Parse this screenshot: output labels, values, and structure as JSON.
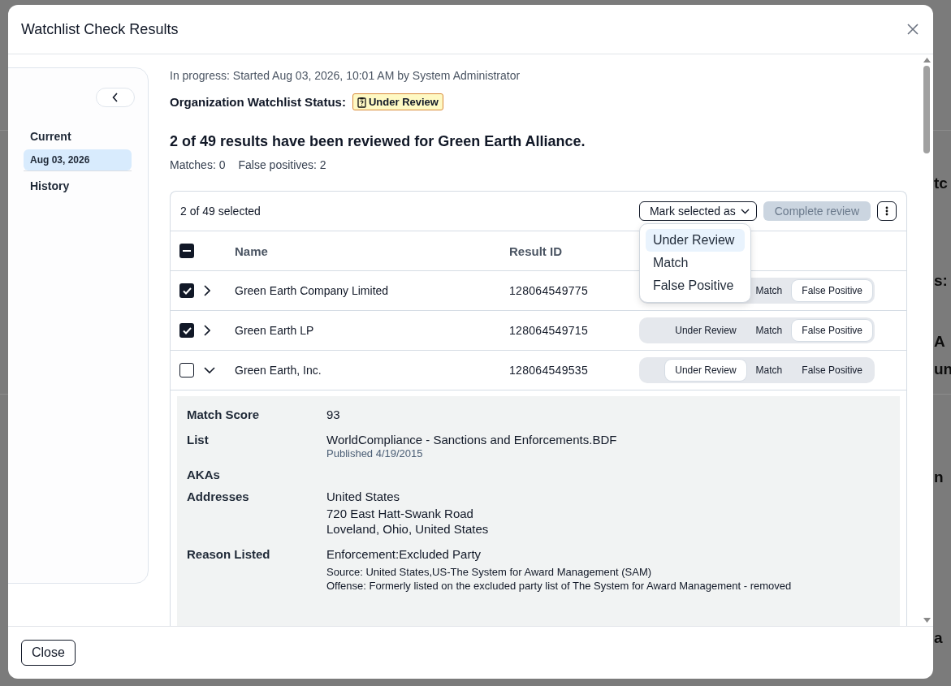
{
  "backdrop": {
    "right_fragments": [
      "tc",
      "s:",
      "A",
      "un",
      "n",
      "a"
    ]
  },
  "window": {
    "title": "Watchlist Check Results"
  },
  "sidebar": {
    "groups": [
      {
        "label": "Current",
        "items": [
          {
            "label": "Aug 03, 2026",
            "selected": true
          }
        ]
      },
      {
        "label": "History"
      }
    ]
  },
  "progress_note": "In progress: Started Aug 03, 2026, 10:01 AM by System Administrator",
  "status": {
    "label": "Organization Watchlist Status:",
    "badge": "Under Review"
  },
  "summary": {
    "heading": "2 of 49 results have been reviewed for Green Earth Alliance.",
    "matches": "Matches: 0",
    "false_positives": "False positives: 2"
  },
  "table": {
    "selection_count": "2 of 49 selected",
    "mark_button": "Mark selected as",
    "complete_button": {
      "label": "Complete review",
      "disabled": true
    },
    "menu": [
      {
        "label": "Under Review",
        "selected": true
      },
      {
        "label": "Match",
        "selected": false
      },
      {
        "label": "False Positive",
        "selected": false
      }
    ],
    "select_all": {
      "indeterminate": true
    },
    "columns": [
      "Name",
      "Result ID"
    ],
    "rows": [
      {
        "checked": true,
        "expanded": false,
        "name": "Green Earth Company Limited",
        "result_id": "128064549775",
        "options": [
          {
            "label": "Match",
            "selected": false
          },
          {
            "label": "False Positive",
            "selected": true
          }
        ]
      },
      {
        "checked": true,
        "expanded": false,
        "name": "Green Earth LP",
        "result_id": "128064549715",
        "options": [
          {
            "label": "Under Review",
            "selected": false
          },
          {
            "label": "Match",
            "selected": false
          },
          {
            "label": "False Positive",
            "selected": true
          }
        ]
      },
      {
        "checked": false,
        "expanded": true,
        "name": "Green Earth, Inc.",
        "result_id": "128064549535",
        "options": [
          {
            "label": "Under Review",
            "selected": true
          },
          {
            "label": "Match",
            "selected": false
          },
          {
            "label": "False Positive",
            "selected": false
          }
        ]
      }
    ],
    "details": [
      {
        "label": "Match Score",
        "lines": [
          {
            "kind": "main",
            "text": "93"
          }
        ]
      },
      {
        "label": "List",
        "lines": [
          {
            "kind": "main",
            "text": "WorldCompliance - Sanctions and Enforcements.BDF"
          },
          {
            "kind": "muted",
            "text": "Published 4/19/2015"
          }
        ]
      },
      {
        "label": "AKAs"
      },
      {
        "label": "Addresses",
        "lines": [
          {
            "kind": "main",
            "text": "United States"
          },
          {
            "kind": "main",
            "text": "720 East Hatt-Swank Road"
          },
          {
            "kind": "tight",
            "text": "Loveland, Ohio, United States"
          }
        ]
      },
      {
        "label": "Reason Listed",
        "lines": [
          {
            "kind": "main",
            "text": "Enforcement:Excluded Party"
          },
          {
            "kind": "small",
            "text": "Source: United States,US-The System for Award Management (SAM)"
          },
          {
            "kind": "small",
            "text": "Offense: Formerly listed on the excluded party list of The System for Award Management - removed"
          }
        ]
      }
    ]
  },
  "footer": {
    "close_button": "Close"
  }
}
